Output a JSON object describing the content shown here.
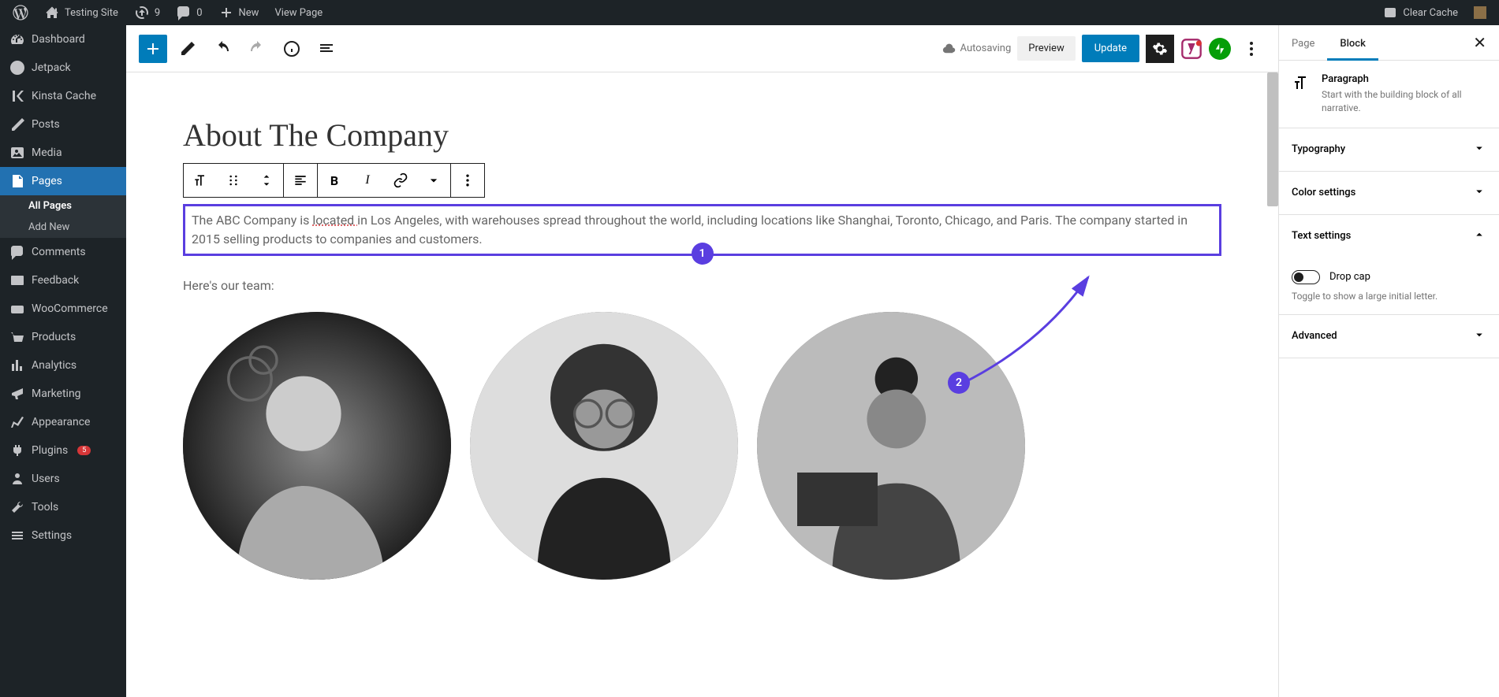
{
  "adminBar": {
    "siteName": "Testing Site",
    "updates": "9",
    "comments": "0",
    "new": "New",
    "viewPage": "View Page",
    "clearCache": "Clear Cache"
  },
  "sidebar": {
    "dashboard": "Dashboard",
    "jetpack": "Jetpack",
    "kinsta": "Kinsta Cache",
    "posts": "Posts",
    "media": "Media",
    "pages": "Pages",
    "allPages": "All Pages",
    "addNew": "Add New",
    "commentsItem": "Comments",
    "feedback": "Feedback",
    "woocommerce": "WooCommerce",
    "products": "Products",
    "analytics": "Analytics",
    "marketing": "Marketing",
    "appearance": "Appearance",
    "plugins": "Plugins",
    "pluginBadge": "5",
    "users": "Users",
    "tools": "Tools",
    "settings": "Settings"
  },
  "editor": {
    "autosaving": "Autosaving",
    "preview": "Preview",
    "update": "Update"
  },
  "content": {
    "title": "About The Company",
    "paragraphPrefix": "The ABC Company is ",
    "paragraphLocated": "located ",
    "paragraphRest": "in Los Angeles, with warehouses spread throughout the world, including locations like Shanghai, Toronto, Chicago, and Paris. The company started in 2015 selling products to companies and customers.",
    "teamText": "Here's our team:"
  },
  "annotations": {
    "badge1": "1",
    "badge2": "2"
  },
  "panel": {
    "tabPage": "Page",
    "tabBlock": "Block",
    "blockName": "Paragraph",
    "blockDesc": "Start with the building block of all narrative.",
    "typography": "Typography",
    "colorSettings": "Color settings",
    "textSettings": "Text settings",
    "dropCap": "Drop cap",
    "dropCapHint": "Toggle to show a large initial letter.",
    "advanced": "Advanced"
  }
}
